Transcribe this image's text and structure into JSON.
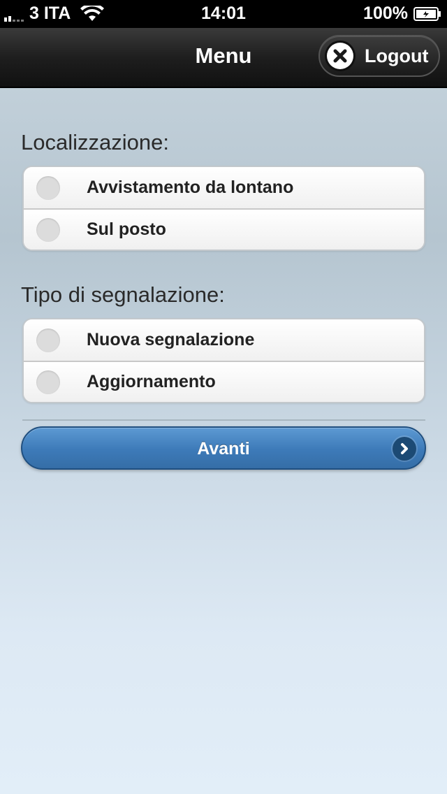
{
  "status_bar": {
    "carrier": "3 ITA",
    "time": "14:01",
    "battery": "100%",
    "icons": [
      "signal-icon",
      "wifi-icon",
      "battery-icon"
    ]
  },
  "header": {
    "title": "Menu",
    "logout_label": "Logout",
    "logout_icon": "close-icon"
  },
  "localizzazione": {
    "label": "Localizzazione:",
    "options": [
      "Avvistamento da lontano",
      "Sul posto"
    ]
  },
  "tipo": {
    "label": "Tipo di segnalazione:",
    "options": [
      "Nuova segnalazione",
      "Aggiornamento"
    ]
  },
  "next_button": {
    "label": "Avanti",
    "icon": "chevron-right-icon"
  },
  "colors": {
    "accent": "#3d7ab8",
    "header": "#1e1e1e"
  }
}
